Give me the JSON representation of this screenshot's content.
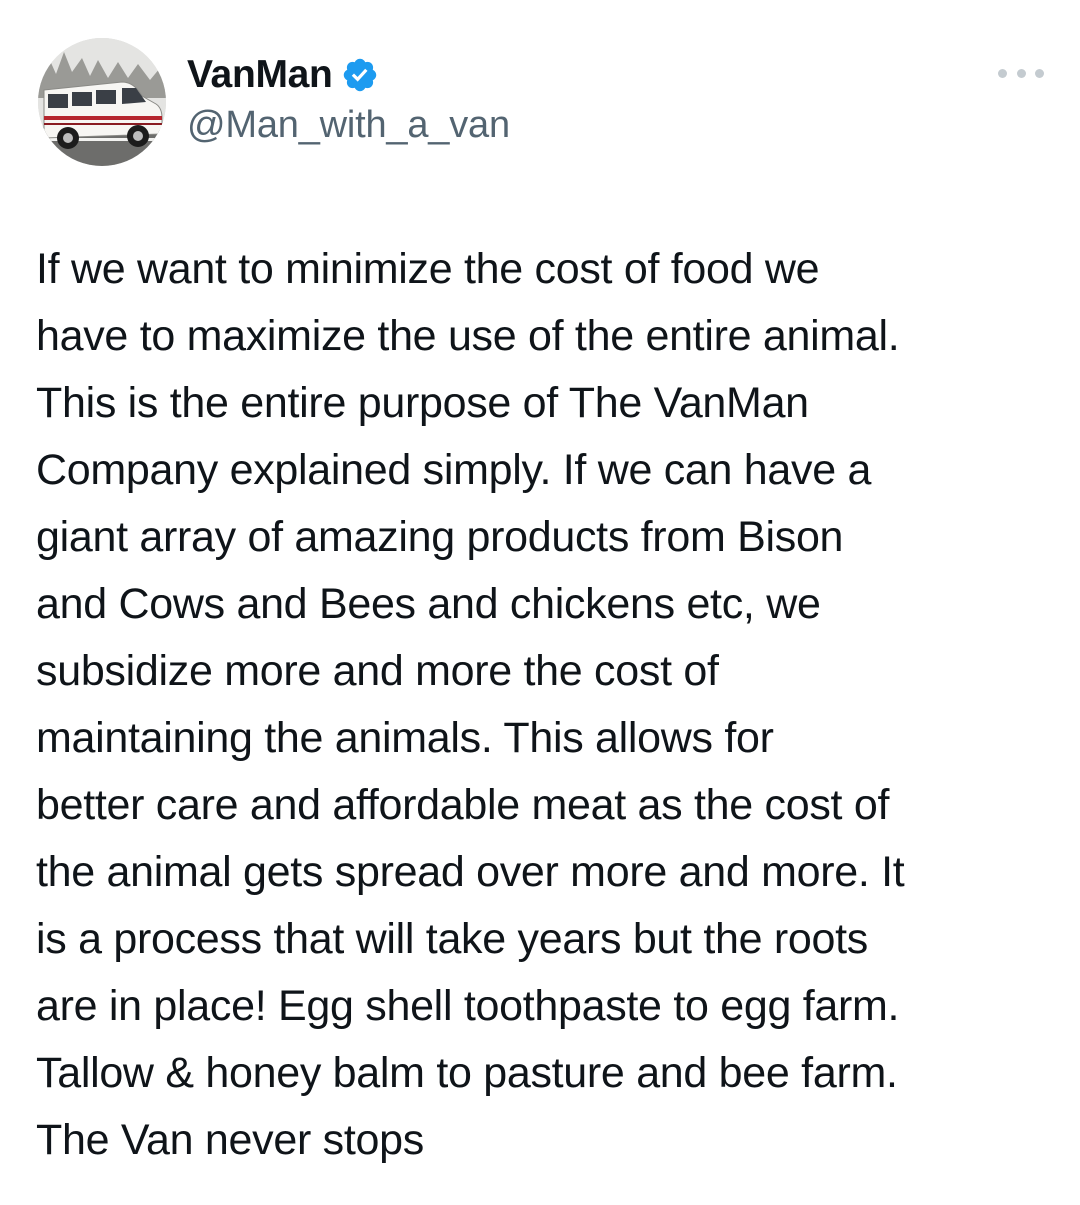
{
  "author": {
    "display_name": "VanMan",
    "handle": "@Man_with_a_van",
    "verified_icon": "verified-badge-icon",
    "avatar": "van-photo-avatar"
  },
  "menu": {
    "icon": "more-options-icon"
  },
  "tweet": {
    "lines": [
      "If we want to minimize the cost of food we",
      "have to maximize the use of the entire animal.",
      "This is the entire purpose of The VanMan",
      "Company explained simply.  If we can have a",
      "giant array of amazing products from Bison",
      "and Cows and Bees and chickens etc, we",
      "subsidize more and more the cost of",
      "maintaining the animals.  This allows for",
      "better care and affordable meat as the cost of",
      "the animal gets spread over more and more.  It",
      "is a process that will take years but the roots",
      "are in place!  Egg shell toothpaste to egg farm.",
      "Tallow & honey balm to pasture and bee farm.",
      "The Van never stops"
    ]
  },
  "colors": {
    "text": "#0f1419",
    "secondary": "#536471",
    "verified": "#1d9bf0",
    "background": "#ffffff"
  }
}
